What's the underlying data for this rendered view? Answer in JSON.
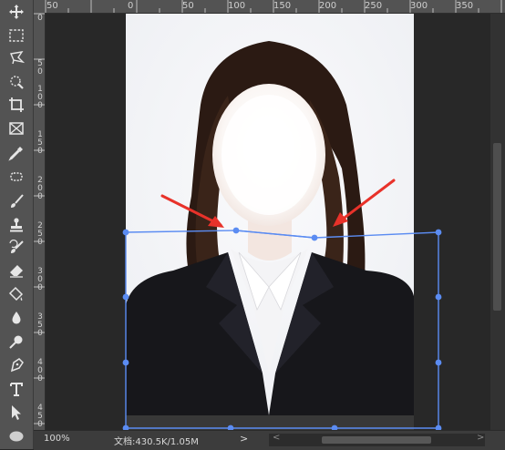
{
  "ruler": {
    "top_labels": [
      "50",
      "0",
      "50",
      "100",
      "150",
      "200",
      "250",
      "300",
      "350"
    ],
    "left_labels": [
      "0",
      "5\n0",
      "1\n0\n0",
      "1\n5\n0",
      "2\n0\n0",
      "2\n5\n0",
      "3\n0\n0",
      "3\n5\n0",
      "4\n0\n0",
      "4\n5\n0"
    ]
  },
  "statusbar": {
    "zoom": "100%",
    "doc_info": "文档:430.5K/1.05M",
    "arrow": ">",
    "scroll_left": "<",
    "scroll_right": ">"
  },
  "tools": [
    "move-tool",
    "marquee-tool",
    "lasso-tool",
    "quick-selection-tool",
    "crop-tool",
    "frame-tool",
    "eyedropper-tool",
    "healing-brush-tool",
    "brush-tool",
    "clone-stamp-tool",
    "history-brush-tool",
    "eraser-tool",
    "paint-bucket-tool",
    "blur-tool",
    "dodge-tool",
    "pen-tool",
    "type-tool",
    "path-selection-tool",
    "ellipse-tool"
  ],
  "colors": {
    "transform_line": "#5b8cf2",
    "arrow": "#e8322a",
    "suit": "#1a1a1e",
    "hair": "#2a1a14",
    "photo_background": "#f6f6f8"
  }
}
